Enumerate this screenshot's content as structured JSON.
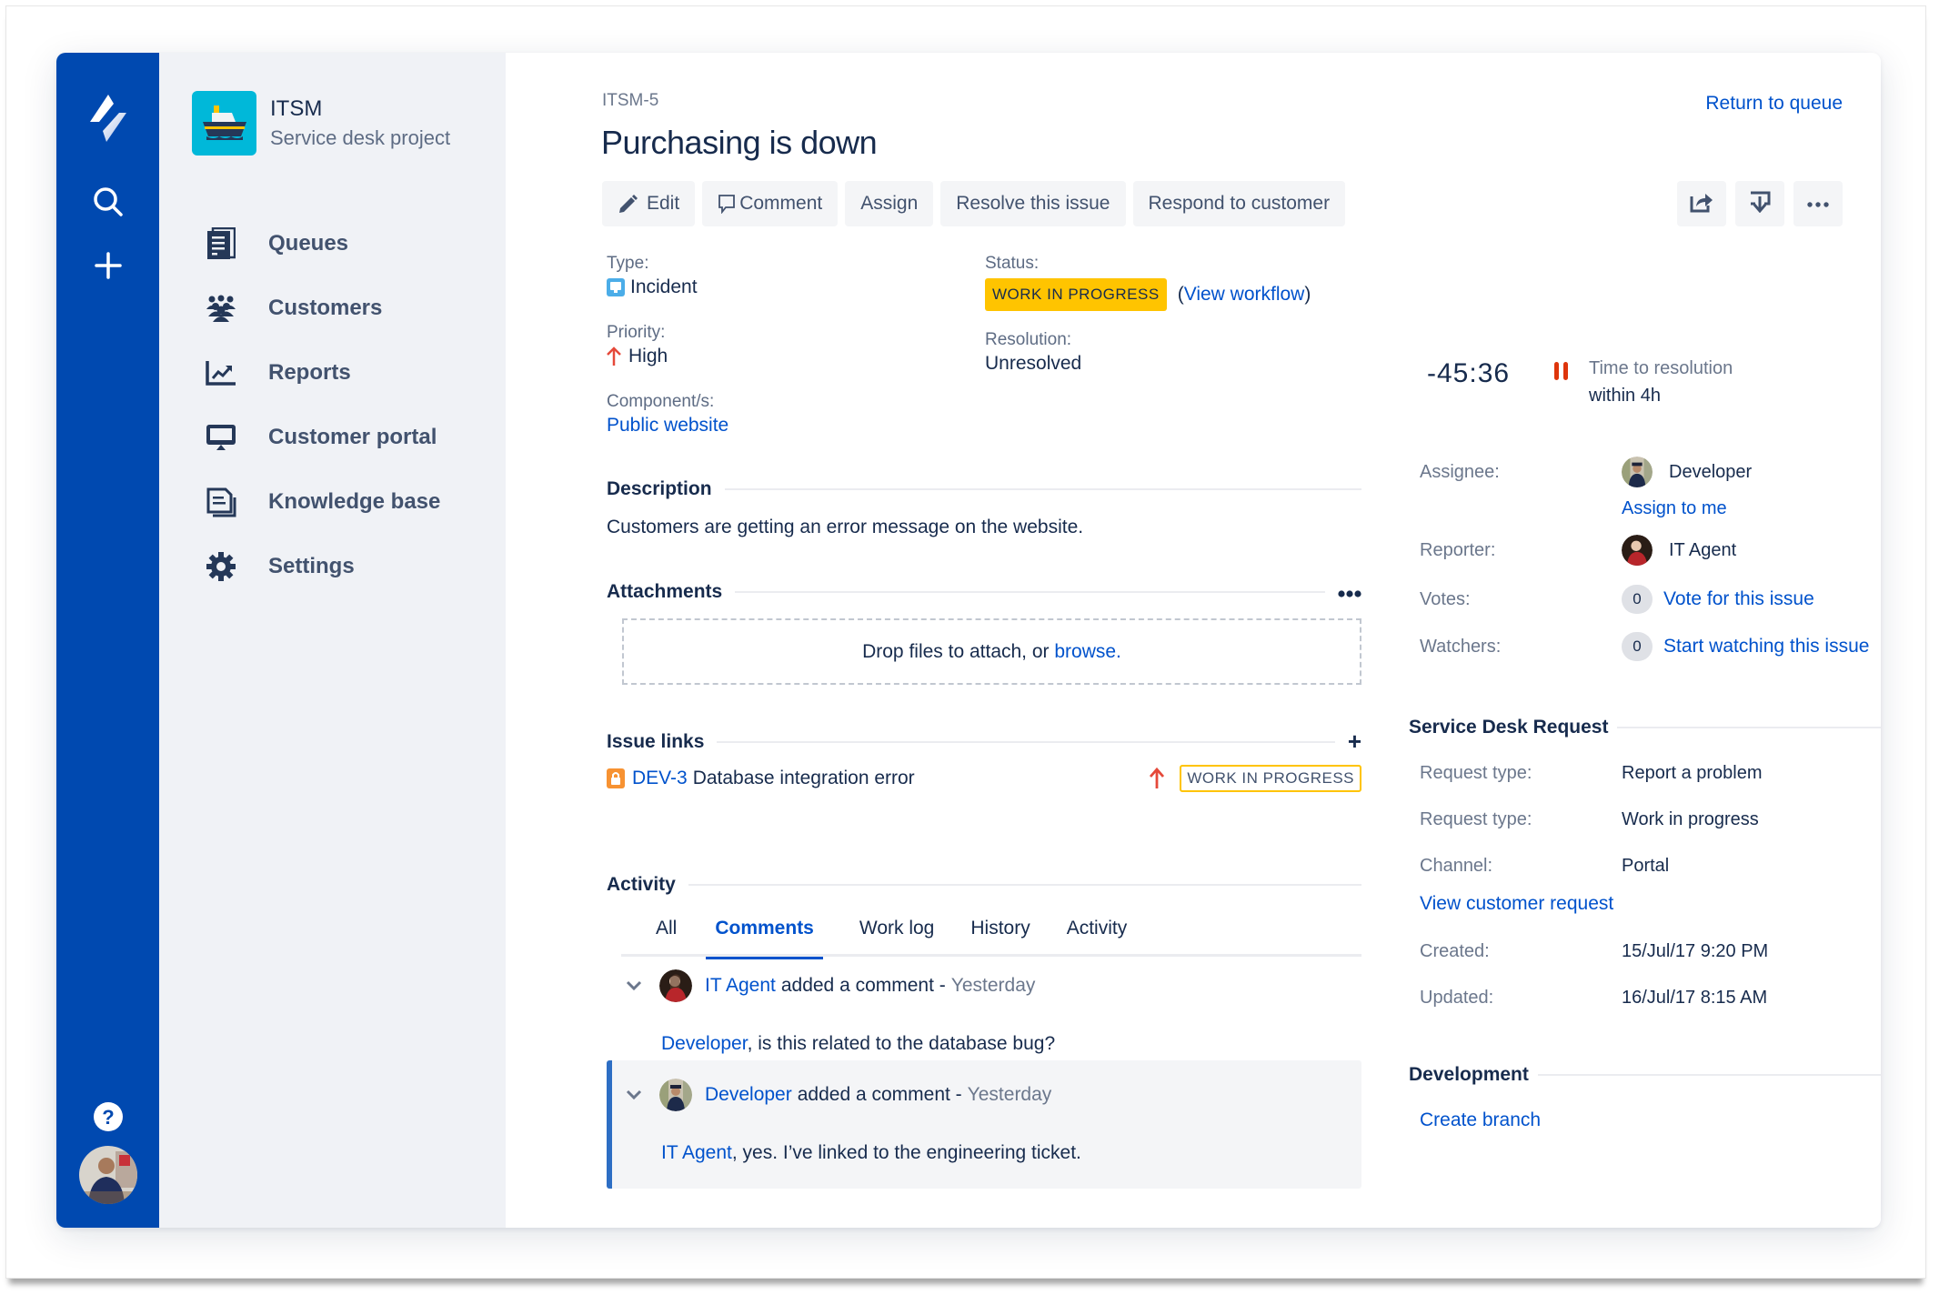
{
  "global_nav": {
    "icons": [
      "jira-logo-icon",
      "search-icon",
      "create-plus-icon",
      "help-icon",
      "user-avatar"
    ]
  },
  "project": {
    "name": "ITSM",
    "type": "Service desk project",
    "nav": [
      {
        "label": "Queues",
        "icon": "queues-icon"
      },
      {
        "label": "Customers",
        "icon": "customers-icon"
      },
      {
        "label": "Reports",
        "icon": "reports-icon"
      },
      {
        "label": "Customer portal",
        "icon": "monitor-icon"
      },
      {
        "label": "Knowledge base",
        "icon": "knowledge-base-icon"
      },
      {
        "label": "Settings",
        "icon": "gear-icon"
      }
    ]
  },
  "issue": {
    "key": "ITSM-5",
    "title": "Purchasing is down",
    "return_link": "Return to queue",
    "toolbar": {
      "edit": "Edit",
      "comment": "Comment",
      "assign": "Assign",
      "resolve": "Resolve this issue",
      "respond": "Respond to customer"
    },
    "fields": {
      "type_label": "Type:",
      "type_value": "Incident",
      "priority_label": "Priority:",
      "priority_value": "High",
      "component_label": "Component/s:",
      "component_value": "Public website",
      "status_label": "Status:",
      "status_value": "WORK IN PROGRESS",
      "view_workflow_open": "(",
      "view_workflow": "View workflow",
      "view_workflow_close": ")",
      "resolution_label": "Resolution:",
      "resolution_value": "Unresolved"
    },
    "description": {
      "heading": "Description",
      "text": "Customers are getting an error message on the website."
    },
    "attachments": {
      "heading": "Attachments",
      "more": "•••",
      "drop_text": "Drop files to attach, or ",
      "browse": "browse."
    },
    "issue_links": {
      "heading": "Issue links",
      "add": "+",
      "items": [
        {
          "key": "DEV-3",
          "summary": "Database integration error",
          "priority": "High",
          "status": "WORK IN PROGRESS"
        }
      ]
    },
    "activity": {
      "heading": "Activity",
      "tabs": [
        "All",
        "Comments",
        "Work log",
        "History",
        "Activity"
      ],
      "active_tab": "Comments",
      "comments": [
        {
          "author": "IT Agent",
          "verb": "added a comment -",
          "time": "Yesterday",
          "mention": "Developer",
          "body": ", is this related to the database bug?"
        },
        {
          "author": "Developer",
          "verb": "added a comment -",
          "time": "Yesterday",
          "mention": "IT Agent",
          "body": ", yes. I’ve linked to the engineering ticket."
        }
      ]
    }
  },
  "side": {
    "sla": {
      "time": "-45:36",
      "label": "Time to resolution",
      "goal": "within 4h"
    },
    "people": {
      "assignee_label": "Assignee:",
      "assignee": "Developer",
      "assign_to_me": "Assign to me",
      "reporter_label": "Reporter:",
      "reporter": "IT Agent",
      "votes_label": "Votes:",
      "votes_count": "0",
      "vote_link": "Vote for this issue",
      "watchers_label": "Watchers:",
      "watchers_count": "0",
      "watch_link": "Start watching this issue"
    },
    "service_desk": {
      "heading": "Service Desk Request",
      "rows": [
        {
          "label": "Request type:",
          "value": "Report a problem"
        },
        {
          "label": "Request type:",
          "value": "Work in progress"
        },
        {
          "label": "Channel:",
          "value": "Portal"
        }
      ],
      "view_link": "View customer request",
      "created_label": "Created:",
      "created": "15/Jul/17 9:20 PM",
      "updated_label": "Updated:",
      "updated": "16/Jul/17 8:15 AM"
    },
    "development": {
      "heading": "Development",
      "create_branch": "Create branch"
    }
  },
  "colors": {
    "brand_blue": "#0049B0",
    "link": "#0052CC",
    "status_yellow": "#FFC400",
    "priority_red": "#E5493A",
    "sla_red": "#DE350B"
  }
}
